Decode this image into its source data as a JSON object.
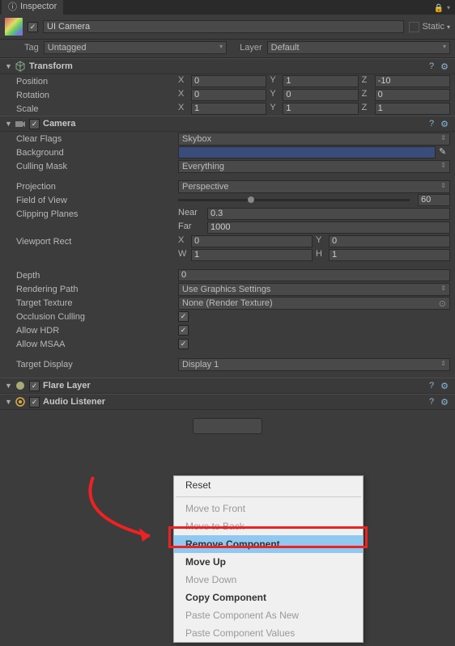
{
  "tab_title": "Inspector",
  "gameobject": {
    "name": "UI Camera",
    "static_label": "Static",
    "tag_label": "Tag",
    "tag_value": "Untagged",
    "layer_label": "Layer",
    "layer_value": "Default"
  },
  "transform": {
    "title": "Transform",
    "position_label": "Position",
    "position": {
      "x": "0",
      "y": "1",
      "z": "-10"
    },
    "rotation_label": "Rotation",
    "rotation": {
      "x": "0",
      "y": "0",
      "z": "0"
    },
    "scale_label": "Scale",
    "scale": {
      "x": "1",
      "y": "1",
      "z": "1"
    }
  },
  "camera": {
    "title": "Camera",
    "clear_flags_label": "Clear Flags",
    "clear_flags_value": "Skybox",
    "background_label": "Background",
    "culling_mask_label": "Culling Mask",
    "culling_mask_value": "Everything",
    "projection_label": "Projection",
    "projection_value": "Perspective",
    "fov_label": "Field of View",
    "fov_value": "60",
    "clipping_label": "Clipping Planes",
    "clipping_near_label": "Near",
    "clipping_near": "0.3",
    "clipping_far_label": "Far",
    "clipping_far": "1000",
    "viewport_label": "Viewport Rect",
    "viewport": {
      "x": "0",
      "y": "0",
      "w": "1",
      "h": "1"
    },
    "depth_label": "Depth",
    "depth_value": "0",
    "rendering_path_label": "Rendering Path",
    "rendering_path_value": "Use Graphics Settings",
    "target_texture_label": "Target Texture",
    "target_texture_value": "None (Render Texture)",
    "occlusion_label": "Occlusion Culling",
    "hdr_label": "Allow HDR",
    "msaa_label": "Allow MSAA",
    "target_display_label": "Target Display",
    "target_display_value": "Display 1"
  },
  "flare_layer": {
    "title": "Flare Layer"
  },
  "audio_listener": {
    "title": "Audio Listener"
  },
  "context_menu": {
    "reset": "Reset",
    "move_front": "Move to Front",
    "move_back": "Move to Back",
    "remove": "Remove Component",
    "move_up": "Move Up",
    "move_down": "Move Down",
    "copy": "Copy Component",
    "paste_new": "Paste Component As New",
    "paste_values": "Paste Component Values"
  },
  "axis": {
    "x": "X",
    "y": "Y",
    "z": "Z",
    "w": "W",
    "h": "H"
  }
}
